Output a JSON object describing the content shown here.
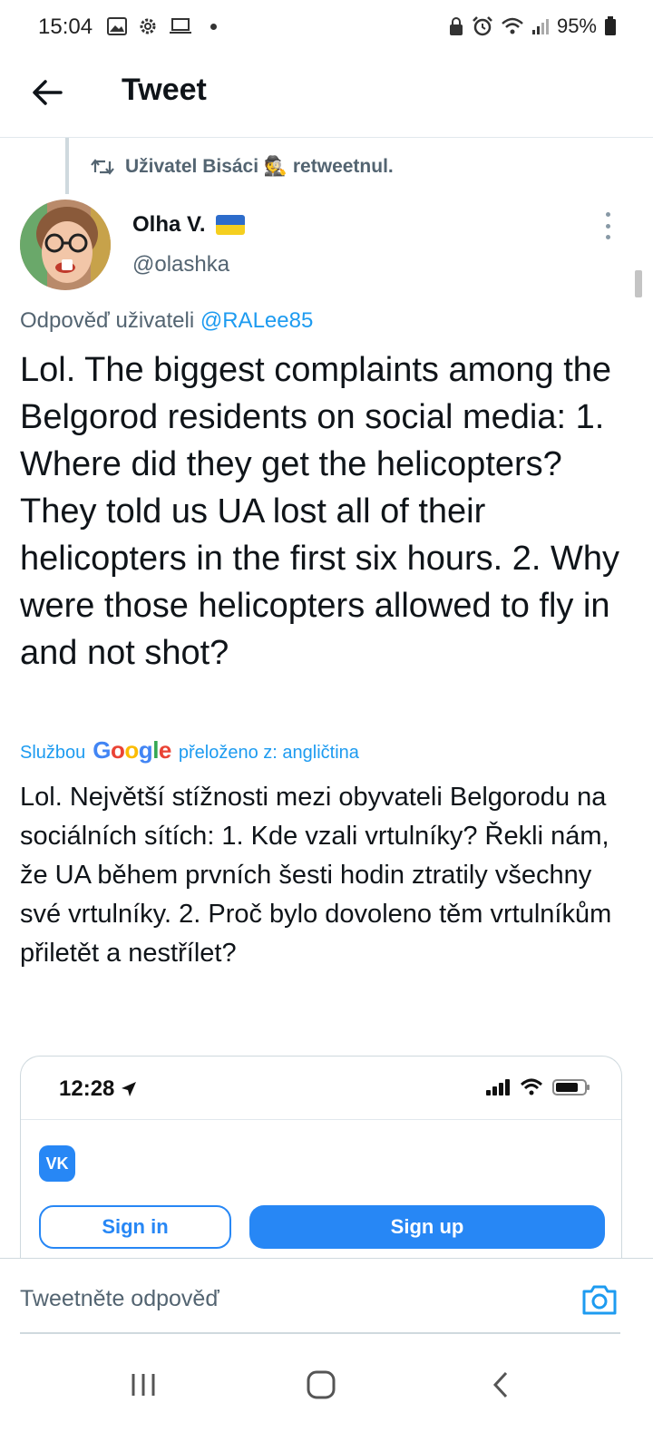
{
  "status_bar": {
    "time": "15:04",
    "battery": "95%"
  },
  "header": {
    "title": "Tweet"
  },
  "retweet": {
    "text": "Uživatel Bisáci 🕵️ retweetnul."
  },
  "author": {
    "name": "Olha V.",
    "handle": "@olashka"
  },
  "reply_context": {
    "prefix": "Odpověď uživateli",
    "mention": "@RALee85"
  },
  "tweet": {
    "text": "Lol. The biggest complaints among the Belgorod residents on social media: 1. Where did they get the helicopters? They told us UA lost all of their helicopters in the first six hours. 2. Why were those helicopters allowed to fly in and not shot?"
  },
  "translation": {
    "prefix": "Službou",
    "brand": "Google",
    "suffix": "přeloženo z: angličtina",
    "text": "Lol. Největší stížnosti mezi obyvateli Belgorodu na sociálních sítích: 1. Kde vzali vrtulníky? Řekli nám, že UA během prvních šesti hodin ztratily všechny své vrtulníky. 2. Proč bylo dovoleno těm vrtulníkům přiletět a nestřílet?"
  },
  "media": {
    "time": "12:28",
    "logo": "VK",
    "sign_in": "Sign in",
    "sign_up": "Sign up"
  },
  "composer": {
    "placeholder": "Tweetněte odpověď"
  },
  "colors": {
    "accent": "#1d9bf0",
    "vk_blue": "#2787f5",
    "secondary_text": "#536471"
  }
}
